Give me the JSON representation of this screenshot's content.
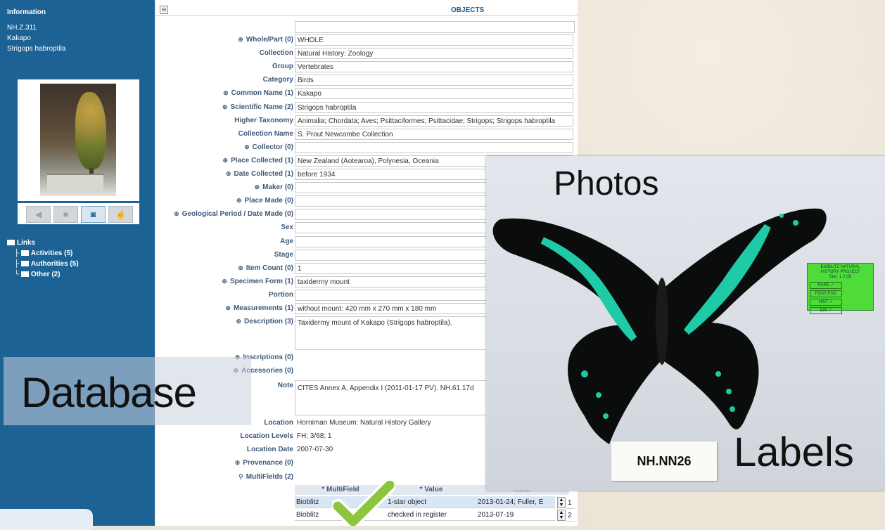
{
  "sidebar": {
    "header": "Information",
    "info_lines": [
      "NH.Z.311",
      "Kakapo",
      "Strigops habroptila"
    ],
    "nav_buttons": [
      "back-icon",
      "square-icon",
      "camera-icon",
      "hand-icon"
    ],
    "links": {
      "title": "Links",
      "items": [
        {
          "label": "Activities (5)"
        },
        {
          "label": "Authorities (5)"
        },
        {
          "label": "Other (2)"
        }
      ]
    }
  },
  "form": {
    "collapse_label": "⊟",
    "title": "OBJECTS",
    "fields": [
      {
        "label": "Whole/Part (0)",
        "value": "WHOLE",
        "icon": true
      },
      {
        "label": "Collection",
        "value": "Natural History: Zoology",
        "icon": false
      },
      {
        "label": "Group",
        "value": "Vertebrates",
        "icon": false
      },
      {
        "label": "Category",
        "value": "Birds",
        "icon": false
      },
      {
        "label": "Common Name (1)",
        "value": "Kakapo",
        "icon": true
      },
      {
        "label": "Scientific Name (2)",
        "value": "Strigops habroptila",
        "icon": true
      },
      {
        "label": "Higher Taxonomy",
        "value": "Animalia; Chordata; Aves; Psittaciformes; Psittacidae; Strigops; Strigops habroptila",
        "icon": false
      },
      {
        "label": "Collection Name",
        "value": "S. Prout Newcombe Collection",
        "icon": false
      },
      {
        "label": "Collector (0)",
        "value": "",
        "icon": true
      },
      {
        "label": "Place Collected (1)",
        "value": "New Zealand (Aotearoa), Polynesia, Oceania",
        "icon": true
      },
      {
        "label": "Date Collected (1)",
        "value": "before 1934",
        "icon": true
      },
      {
        "label": "Maker (0)",
        "value": "",
        "icon": true
      },
      {
        "label": "Place Made (0)",
        "value": "",
        "icon": true
      },
      {
        "label": "Geological Period / Date Made (0)",
        "value": "",
        "icon": true
      },
      {
        "label": "Sex",
        "value": "",
        "icon": false
      },
      {
        "label": "Age",
        "value": "",
        "icon": false
      },
      {
        "label": "Stage",
        "value": "",
        "icon": false
      },
      {
        "label": "Item Count (0)",
        "value": "1",
        "icon": true
      },
      {
        "label": "Specimen Form (1)",
        "value": "taxidermy mount",
        "icon": true
      },
      {
        "label": "Portion",
        "value": "",
        "icon": false
      },
      {
        "label": "Measurements (1)",
        "value": "without mount: 420 mm x 270 mm x 180 mm",
        "icon": true
      },
      {
        "label": "Description (3)",
        "value": "Taxidermy mount of Kakapo (Strigops habroptila).",
        "icon": true
      }
    ],
    "fields2": [
      {
        "label": "Inscriptions (0)",
        "value": "",
        "icon": true
      },
      {
        "label": "Accessories (0)",
        "value": "",
        "icon": true
      }
    ],
    "note_label": "Note",
    "note_value": "CITES Annex A, Appendix I (2011-01-17 PV). NH.61.17d",
    "fields3": [
      {
        "label": "Location",
        "value": "Horniman Museum: Natural History Gallery"
      },
      {
        "label": "Location Levels",
        "value": "FH; 3/68; 1"
      },
      {
        "label": "Location Date",
        "value": "2007-07-30"
      }
    ],
    "provenance_label": "Provenance (0)",
    "multifields_label": "MultiFields (2)",
    "multifield_table": {
      "headers": [
        "* MultiField",
        "* Value",
        "Note"
      ],
      "rows": [
        [
          "Bioblitz",
          "1-star object",
          "2013-01-24; Fuller, E"
        ],
        [
          "Bioblitz",
          "checked in register",
          "2013-07-19"
        ]
      ],
      "row_numbers": [
        "1",
        "2"
      ]
    }
  },
  "overlays": {
    "database": "Database",
    "photos": "Photos",
    "labels": "Labels",
    "specimen_tag": "NH.NN26",
    "green_label": {
      "lines": [
        "BIOBLITZ NATURAL",
        "HISTORY PROJECT"
      ],
      "star_line": "Star: 1  2  (3)",
      "cells": [
        "RARE ✓",
        "FOSS END",
        "HIST ✓",
        "DIS ✓"
      ]
    }
  },
  "colors": {
    "sidebar": "#1d6294",
    "label_text": "#3e5878",
    "butterfly_wing": "#0b0d0c",
    "butterfly_band": "#1fcaa6",
    "green_label": "#4fdc39"
  }
}
